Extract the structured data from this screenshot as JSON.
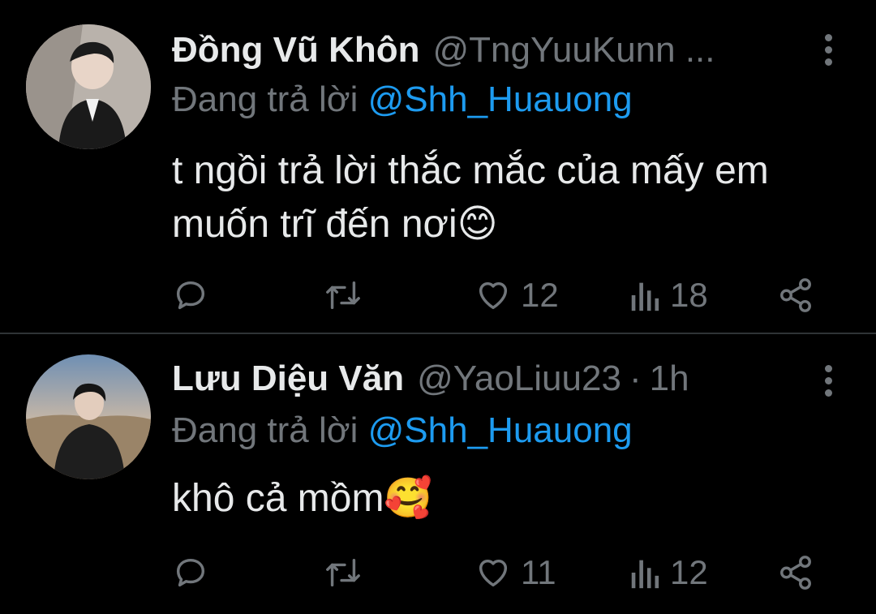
{
  "tweets": [
    {
      "name": "Đồng Vũ Khôn",
      "handle": "@TngYuuKunn ...",
      "time": "",
      "reply_prefix": "Đang trả lời",
      "reply_to": "@Shh_Huauong",
      "text": "t ngồi trả lời thắc mắc của mấy em muốn trĩ đến nơi😊",
      "likes": "12",
      "views": "18"
    },
    {
      "name": "Lưu Diệu Văn",
      "handle": "@YaoLiuu23",
      "time": "1h",
      "reply_prefix": "Đang trả lời",
      "reply_to": "@Shh_Huauong",
      "text": "khô cả mồm🥰",
      "likes": "11",
      "views": "12"
    }
  ],
  "icons": {
    "reply": "reply-icon",
    "retweet": "retweet-icon",
    "like": "heart-icon",
    "views": "views-icon",
    "share": "share-icon",
    "more": "more-icon"
  },
  "colors": {
    "background": "#000000",
    "text": "#e7e9ea",
    "muted": "#71767b",
    "mention": "#1d9bf0",
    "divider": "#2f3336"
  }
}
